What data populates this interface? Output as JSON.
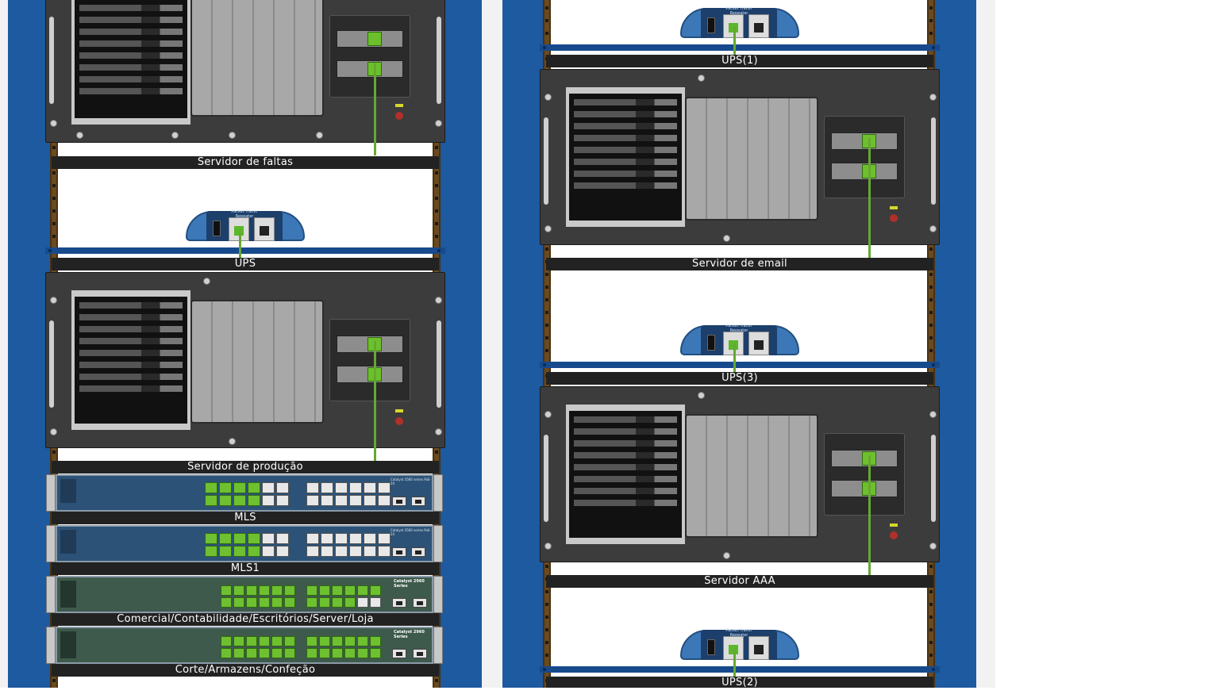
{
  "rack_left": {
    "devices": [
      {
        "kind": "server",
        "label": "Servidor de faltas"
      },
      {
        "kind": "ups",
        "label": "UPS",
        "brand_text": "Packet Tracer Repeater"
      },
      {
        "kind": "server",
        "label": "Servidor de produção"
      },
      {
        "kind": "switch-3560",
        "label": "MLS",
        "model_text": "Catalyst 3560 series PoE-24"
      },
      {
        "kind": "switch-3560",
        "label": "MLS1",
        "model_text": "Catalyst 3560 series PoE-24"
      },
      {
        "kind": "switch-2960",
        "label": "Comercial/Contabilidade/Escritórios/Server/Loja",
        "model_text": "Catalyst 2960 Series"
      },
      {
        "kind": "switch-2960",
        "label": "Corte/Armazens/Confeção",
        "model_text": "Catalyst 2960 Series"
      }
    ]
  },
  "rack_right": {
    "devices": [
      {
        "kind": "ups",
        "label": "UPS(1)",
        "brand_text": "Packet Tracer Repeater"
      },
      {
        "kind": "server",
        "label": "Servidor de email"
      },
      {
        "kind": "ups",
        "label": "UPS(3)",
        "brand_text": "Packet Tracer Repeater"
      },
      {
        "kind": "server",
        "label": "Servidor AAA"
      },
      {
        "kind": "ups",
        "label": "UPS(2)",
        "brand_text": "Packet Tracer Repeater"
      }
    ]
  },
  "colors": {
    "rack_frame": "#1d5aa0",
    "cable": "#66a832",
    "port_active": "#6cc02c",
    "label_bg": "#222222"
  }
}
